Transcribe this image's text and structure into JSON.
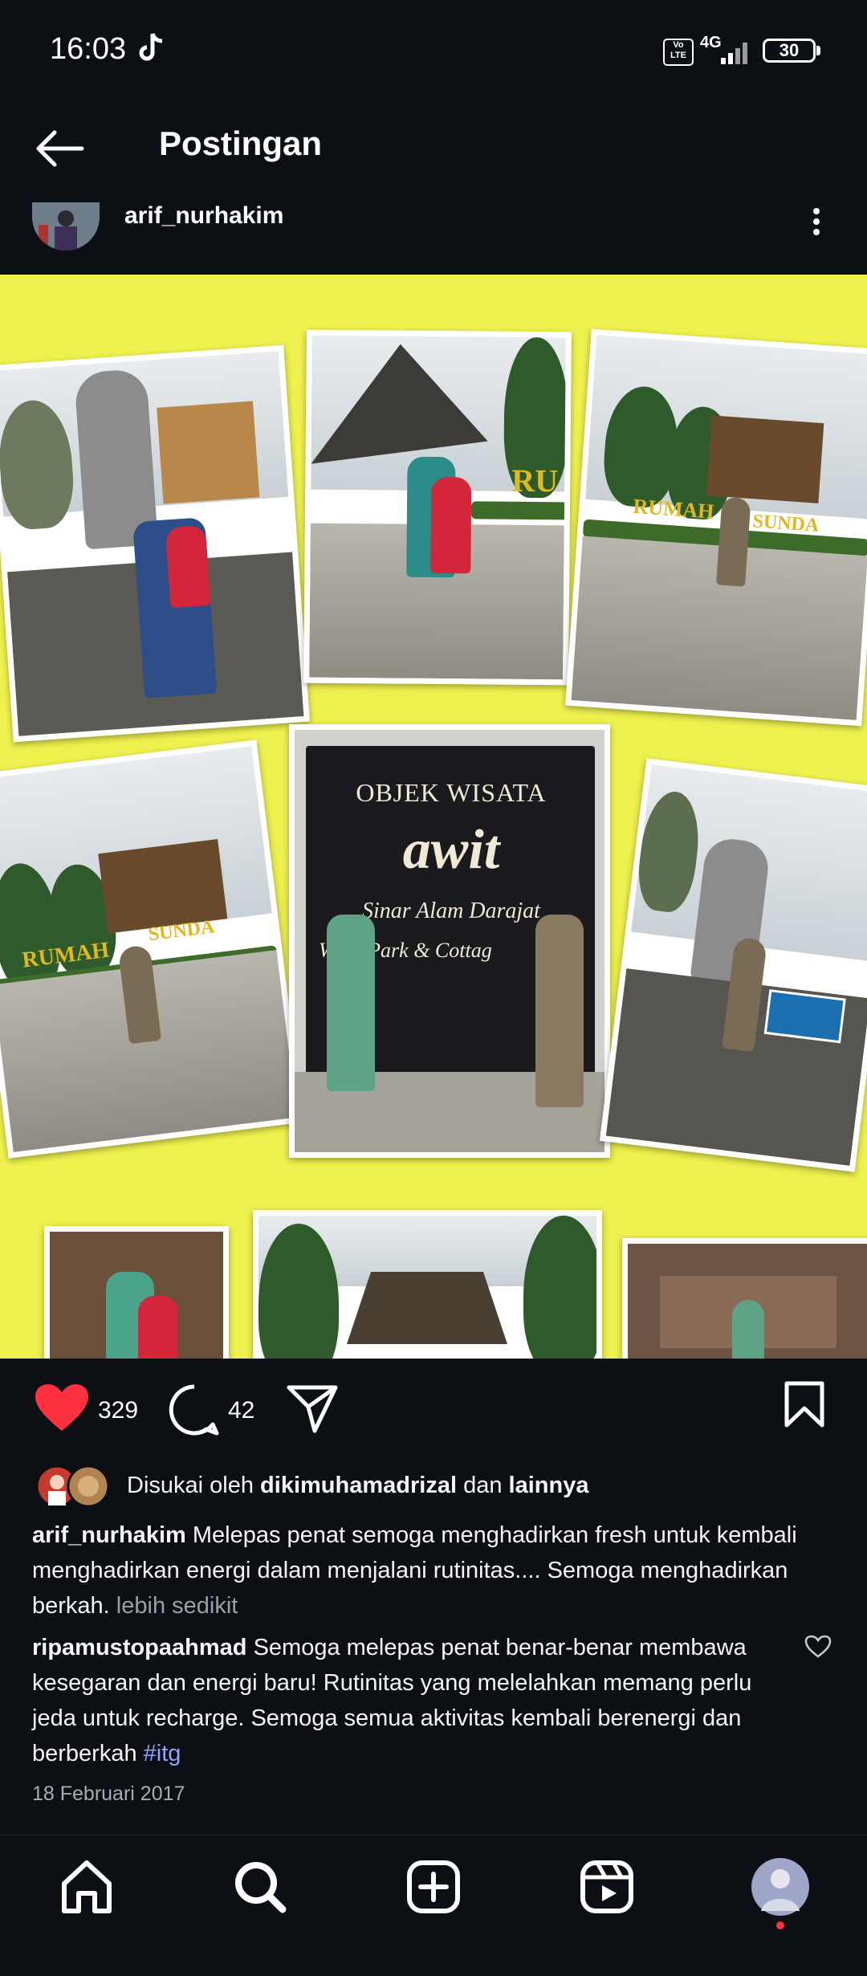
{
  "status_bar": {
    "time": "16:03",
    "network": "4G",
    "volte": "Vo LTE",
    "battery": "30",
    "icons": [
      "tiktok-icon",
      "volte-icon",
      "signal-icon",
      "battery-icon"
    ]
  },
  "header": {
    "back_icon": "arrow-left-icon",
    "title": "Postingan"
  },
  "post": {
    "username": "arif_nurhakim",
    "more_icon": "more-vertical-icon",
    "photo": {
      "background_color": "#eef14e",
      "board_lines": [
        "OBJEK WISATA",
        "awit",
        "Sinar Alam Darajat",
        "WaterPark & Cottag"
      ],
      "sign_texts": [
        "RU",
        "RUMAH",
        "SUNDA",
        "RUMAH",
        "SUNDA"
      ]
    },
    "actions": {
      "like_icon": "heart-filled-icon",
      "like_count": "329",
      "comment_icon": "comment-icon",
      "comment_count": "42",
      "share_icon": "send-icon",
      "save_icon": "bookmark-icon",
      "like_color": "#ff3040"
    },
    "liked_by": {
      "prefix": "Disukai oleh",
      "user": "dikimuhamadrizal",
      "conjunction": "dan",
      "others": "lainnya"
    },
    "caption": {
      "username": "arif_nurhakim",
      "text": "Melepas penat semoga menghadirkan fresh untuk kembali menghadirkan energi dalam menjalani rutinitas.... Semoga menghadirkan berkah.",
      "less_label": "lebih sedikit"
    },
    "comment": {
      "username": "ripamustopaahmad",
      "text": "Semoga melepas penat benar-benar membawa kesegaran dan energi baru! Rutinitas yang melelahkan memang perlu jeda untuk recharge. Semoga semua aktivitas kembali berenergi dan berberkah",
      "hashtag": "#itg",
      "like_icon": "heart-outline-icon"
    },
    "date": "18 Februari 2017"
  },
  "bottom_nav": {
    "items": [
      "home-icon",
      "search-icon",
      "create-icon",
      "reels-icon",
      "profile-avatar"
    ]
  }
}
